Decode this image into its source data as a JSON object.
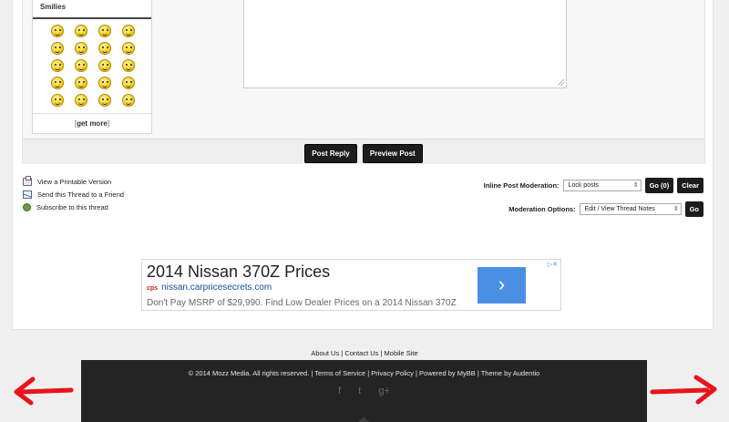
{
  "smilies": {
    "title": "Smilies",
    "get_more": "get more",
    "bracket_open": "[",
    "bracket_close": "]",
    "count": 20
  },
  "quick_reply": {
    "post_reply": "Post Reply",
    "preview_post": "Preview Post"
  },
  "thread_tools": [
    {
      "label": "View a Printable Version",
      "icon": "printer-icon"
    },
    {
      "label": "Send this Thread to a Friend",
      "icon": "envelope-icon"
    },
    {
      "label": "Subscribe to this thread",
      "icon": "subscribe-icon"
    }
  ],
  "moderation": {
    "inline_label": "Inline Post Moderation:",
    "inline_value": "Lock posts",
    "inline_go": "Go (0)",
    "inline_clear": "Clear",
    "options_label": "Moderation Options:",
    "options_value": "Edit / View Thread Notes",
    "options_go": "Go"
  },
  "ad": {
    "title": "2014 Nissan 370Z Prices",
    "url": "nissan.carpricesecrets.com",
    "mark": "cps",
    "description": "Don't Pay MSRP of $29,990. Find Low Dealer Prices on a 2014 Nissan 370Z",
    "arrow": "›",
    "choices": "▷✕"
  },
  "footer": {
    "links": "About Us | Contact Us | Mobile Site",
    "copyright": "© 2014 Mozz Media. All rights reserved.  |  Terms of Service | Privacy Policy | Powered by MyBB | Theme by Audentio",
    "social": [
      "f",
      "t",
      "g+"
    ]
  },
  "colors": {
    "annotation_arrow": "#e8141c",
    "button": "#1c1c1c",
    "ad_accent": "#4a90e2"
  }
}
